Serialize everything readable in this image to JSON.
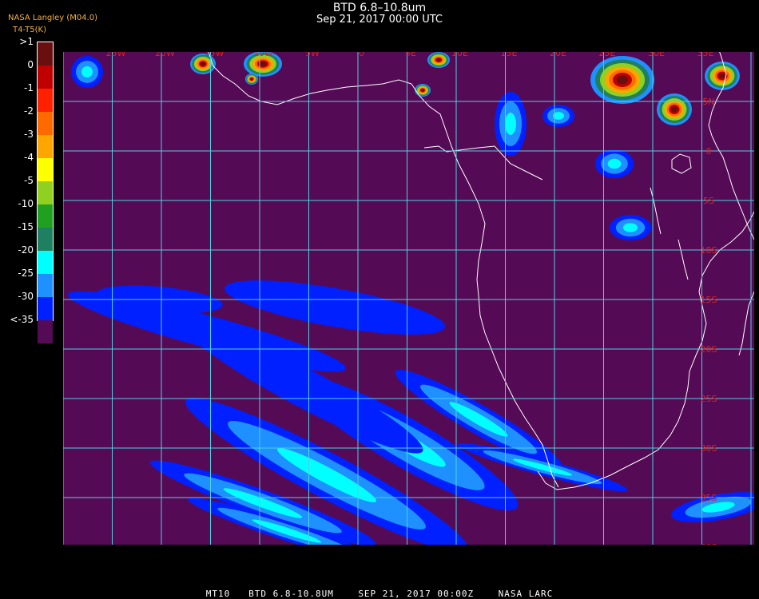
{
  "header": {
    "title": "BTD 6.8–10.8um",
    "subtitle": "Sep 21, 2017 00:00 UTC",
    "credit": "NASA Langley (M04.0)",
    "unit": "T4-T5(K)"
  },
  "legend": {
    "labels": [
      ">1",
      "0",
      "-1",
      "-2",
      "-3",
      "-4",
      "-5",
      "-10",
      "-15",
      "-20",
      "-25",
      "-30",
      "<-35"
    ],
    "colors": [
      "#6a0f0f",
      "#c00000",
      "#ff2000",
      "#ff6a00",
      "#ffa500",
      "#ffff00",
      "#8fd020",
      "#20a020",
      "#1e8060",
      "#00ffff",
      "#1e90ff",
      "#0020ff",
      "#550a55"
    ]
  },
  "map": {
    "background_color": "#550a55",
    "grid_color": "#4fd0e0",
    "coast_color": "#ffffff",
    "lon_labels": [
      "25W",
      "20W",
      "15W",
      "10W",
      "5W",
      "0",
      "5E",
      "10E",
      "15E",
      "20E",
      "25E",
      "30E",
      "35E"
    ],
    "lat_labels": [
      "5N",
      "0",
      "5S",
      "10S",
      "15S",
      "20S",
      "25S",
      "30S",
      "35S",
      "40S"
    ],
    "label_color": "#e02020"
  },
  "footer": {
    "text": "MT10   BTD 6.8-10.8UM    SEP 21, 2017 00:00Z    NASA LARC"
  }
}
